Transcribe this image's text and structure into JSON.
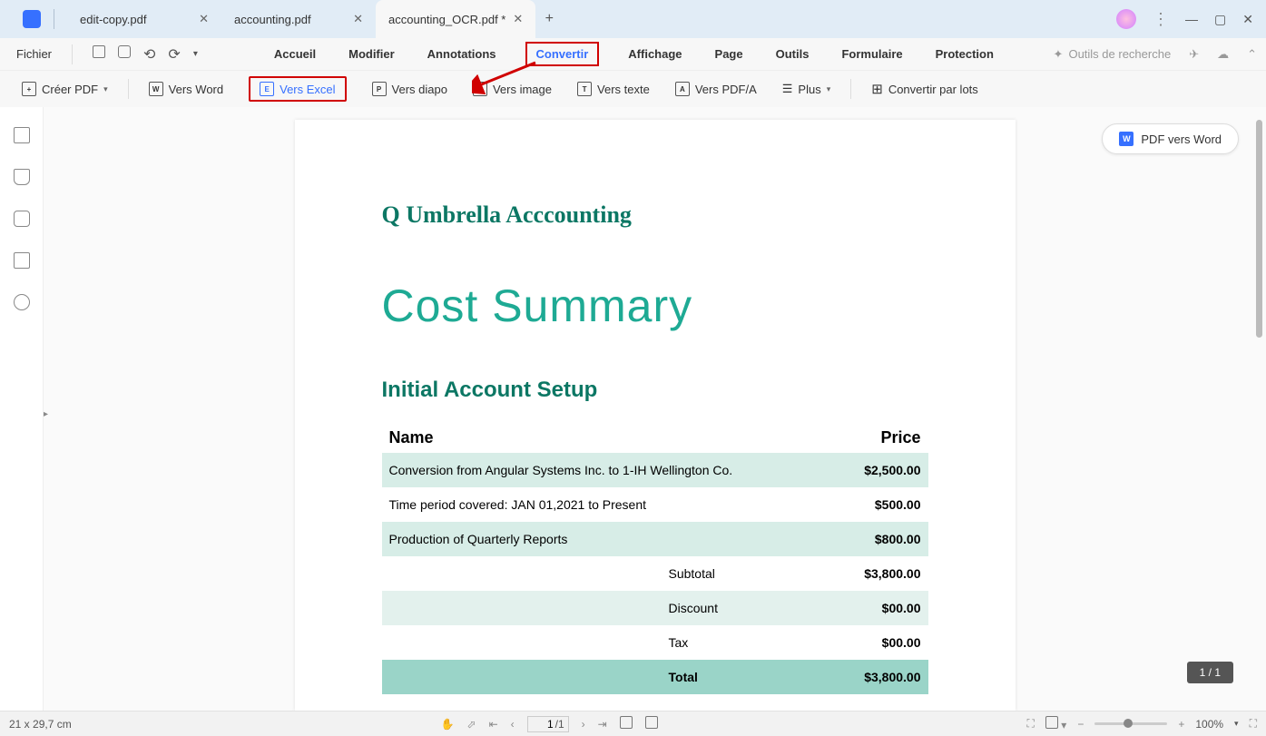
{
  "tabs": [
    {
      "label": "edit-copy.pdf",
      "active": false
    },
    {
      "label": "accounting.pdf",
      "active": false
    },
    {
      "label": "accounting_OCR.pdf *",
      "active": true
    }
  ],
  "menu": {
    "file": "Fichier",
    "items": [
      "Accueil",
      "Modifier",
      "Annotations",
      "Convertir",
      "Affichage",
      "Page",
      "Outils",
      "Formulaire",
      "Protection"
    ],
    "active_index": 3,
    "search_tools": "Outils de recherche"
  },
  "toolbar": {
    "create_pdf": "Créer PDF",
    "to_word": "Vers Word",
    "to_excel": "Vers Excel",
    "to_diapo": "Vers diapo",
    "to_image": "Vers image",
    "to_texte": "Vers texte",
    "to_pdfa": "Vers PDF/A",
    "plus": "Plus",
    "batch": "Convertir par lots"
  },
  "float_button": "PDF vers Word",
  "document": {
    "company": "Q Umbrella Acccounting",
    "title": "Cost Summary",
    "subtitle": "Initial Account Setup",
    "table": {
      "col_name": "Name",
      "col_price": "Price",
      "rows": [
        {
          "name": "Conversion from Angular Systems Inc. to 1-IH Wellington Co.",
          "price": "$2,500.00",
          "shade": true
        },
        {
          "name": "Time period covered: JAN 01,2021 to Present",
          "price": "$500.00",
          "shade": false
        },
        {
          "name": "Production of Quarterly Reports",
          "price": "$800.00",
          "shade": true
        }
      ],
      "summary": [
        {
          "label": "Subtotal",
          "value": "$3,800.00",
          "style": "plain"
        },
        {
          "label": "Discount",
          "value": "$00.00",
          "style": "light"
        },
        {
          "label": "Tax",
          "value": "$00.00",
          "style": "plain"
        },
        {
          "label": "Total",
          "value": "$3,800.00",
          "style": "strong"
        }
      ]
    }
  },
  "status": {
    "dimensions": "21 x 29,7 cm",
    "page_current": "1",
    "page_total": "/1",
    "zoom": "100%"
  },
  "page_badge": "1 / 1"
}
